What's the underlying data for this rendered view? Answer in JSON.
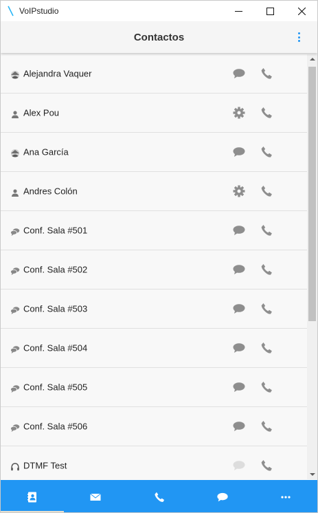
{
  "window": {
    "app_name": "VoIPstudio"
  },
  "header": {
    "title": "Contactos"
  },
  "contacts": [
    {
      "name": "Alejandra Vaquer",
      "type_icon": "user-circle-icon",
      "action1_icon": "chat-bubble-icon",
      "action2_icon": "phone-icon"
    },
    {
      "name": "Alex Pou",
      "type_icon": "person-icon",
      "action1_icon": "gear-icon",
      "action2_icon": "phone-icon"
    },
    {
      "name": "Ana García",
      "type_icon": "user-circle-icon",
      "action1_icon": "chat-bubble-icon",
      "action2_icon": "phone-icon"
    },
    {
      "name": "Andres Colón",
      "type_icon": "person-icon",
      "action1_icon": "gear-icon",
      "action2_icon": "phone-icon"
    },
    {
      "name": "Conf. Sala #501",
      "type_icon": "conference-icon",
      "action1_icon": "chat-bubble-icon",
      "action2_icon": "phone-icon"
    },
    {
      "name": "Conf. Sala #502",
      "type_icon": "conference-icon",
      "action1_icon": "chat-bubble-icon",
      "action2_icon": "phone-icon"
    },
    {
      "name": "Conf. Sala #503",
      "type_icon": "conference-icon",
      "action1_icon": "chat-bubble-icon",
      "action2_icon": "phone-icon"
    },
    {
      "name": "Conf. Sala #504",
      "type_icon": "conference-icon",
      "action1_icon": "chat-bubble-icon",
      "action2_icon": "phone-icon"
    },
    {
      "name": "Conf. Sala #505",
      "type_icon": "conference-icon",
      "action1_icon": "chat-bubble-icon",
      "action2_icon": "phone-icon"
    },
    {
      "name": "Conf. Sala #506",
      "type_icon": "conference-icon",
      "action1_icon": "chat-bubble-icon",
      "action2_icon": "phone-icon"
    },
    {
      "name": "DTMF Test",
      "type_icon": "headset-icon",
      "action1_icon": "chat-bubble-disabled-icon",
      "action2_icon": "phone-icon"
    }
  ],
  "bottom_nav": [
    {
      "icon": "contacts-book-icon",
      "selected": true
    },
    {
      "icon": "envelope-icon",
      "selected": false
    },
    {
      "icon": "phone-icon",
      "selected": false
    },
    {
      "icon": "chat-bubble-icon",
      "selected": false
    },
    {
      "icon": "more-dots-icon",
      "selected": false
    }
  ],
  "colors": {
    "accent": "#2196f3",
    "icon_gray": "#8e8e8e",
    "icon_disabled": "#dddddd",
    "nav_indicator": "#e8e0cf"
  }
}
